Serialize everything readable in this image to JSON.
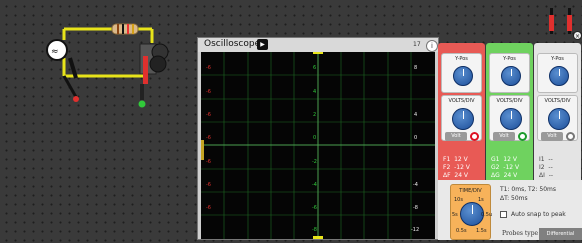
{
  "oscilloscope": {
    "title": "Oscilloscope",
    "run_icon": "play-icon",
    "header_number": "17",
    "info_icon": "info-icon",
    "left_scale": [
      "-6",
      "-6",
      "-6",
      "-6",
      "-6",
      "-6",
      "-6",
      "-6"
    ],
    "green_scale": [
      "6",
      "4",
      "2",
      "0",
      "-2",
      "-4",
      "-6",
      "-8"
    ],
    "red_scale": [
      "8",
      "4",
      "0",
      "-4",
      "-8",
      "-12"
    ],
    "white_scale": [
      "8",
      "4",
      "0",
      "-4",
      "-8",
      "-12"
    ],
    "top_ticks": "17",
    "bottom_ticks": "-12"
  },
  "channel1": {
    "ypos_label": "Y-Pos",
    "volts_label": "VOLTS/DIV",
    "volt_button": "Volt",
    "f1": "F1  12 V",
    "f2": "F2  -12 V",
    "df": "ΔF  24 V",
    "color": "#e85a55"
  },
  "channel2": {
    "ypos_label": "Y-Pos",
    "volts_label": "VOLTS/DIV",
    "volt_button": "Volt",
    "g1": "G1  12 V",
    "g2": "G2  -12 V",
    "dg": "ΔG  24 V",
    "color": "#6fd25f"
  },
  "channel3": {
    "ypos_label": "Y-Pos",
    "volts_label": "VOLTS/DIV",
    "volt_button": "Volt",
    "i1": "I1  --",
    "i2": "I2  --",
    "di": "ΔI  --"
  },
  "time": {
    "label": "TIME/DIV",
    "t1t2": "T1: 0ms, T2: 50ms",
    "dt": "ΔT: 50ms",
    "auto_snap": "Auto snap to peak",
    "probes_type": "Probes type",
    "differential": "Differential",
    "knob_marks": [
      "10s",
      "1s",
      "0.5s",
      "5s",
      "0.5u",
      "1.5s",
      "0.1u"
    ]
  },
  "colors": {
    "trace_red": "#e0302e",
    "trace_green": "#31c93a",
    "wire_yellow": "#e8e41a"
  }
}
